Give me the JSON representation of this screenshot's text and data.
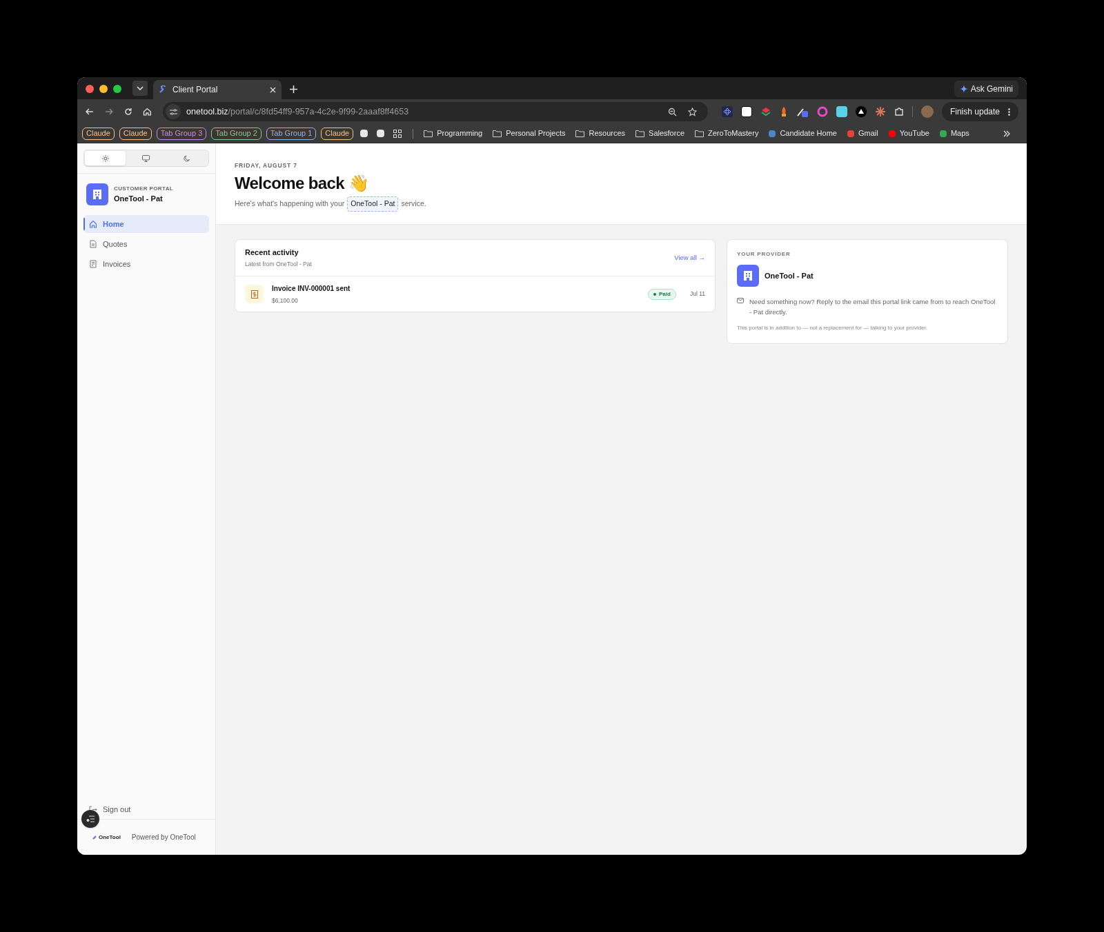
{
  "browser": {
    "tab": {
      "title": "Client Portal"
    },
    "ask_button": "Ask Gemini",
    "url": {
      "host": "onetool.biz",
      "path": "/portal/c/8fd54ff9-957a-4c2e-9f99-2aaaf8ff4653"
    },
    "update_button": "Finish update",
    "bookmarks": [
      {
        "kind": "group",
        "label": "Claude",
        "color": "#f2c48d"
      },
      {
        "kind": "group",
        "label": "Claude",
        "color": "#f2c48d"
      },
      {
        "kind": "group",
        "label": "Tab Group 3",
        "color": "#c58af9"
      },
      {
        "kind": "group",
        "label": "Tab Group 2",
        "color": "#81c995"
      },
      {
        "kind": "group",
        "label": "Tab Group 1",
        "color": "#8ab4f8"
      },
      {
        "kind": "group",
        "label": "Claude",
        "color": "#f2c48d"
      },
      {
        "kind": "page"
      },
      {
        "kind": "page"
      },
      {
        "kind": "apps"
      },
      {
        "kind": "folder",
        "label": "Programming"
      },
      {
        "kind": "folder",
        "label": "Personal Projects"
      },
      {
        "kind": "folder",
        "label": "Resources"
      },
      {
        "kind": "folder",
        "label": "Salesforce"
      },
      {
        "kind": "folder",
        "label": "ZeroToMastery"
      },
      {
        "kind": "site",
        "label": "Candidate Home",
        "color": "#4a86c8"
      },
      {
        "kind": "site",
        "label": "Gmail",
        "color": "#ea4335"
      },
      {
        "kind": "site",
        "label": "YouTube",
        "color": "#ff0000"
      },
      {
        "kind": "site",
        "label": "Maps",
        "color": "#34a853"
      }
    ]
  },
  "theme_toggle": [
    {
      "kind": "light",
      "selected": true
    },
    {
      "kind": "system",
      "selected": false
    },
    {
      "kind": "dark",
      "selected": false
    }
  ],
  "brand": {
    "eyebrow": "CUSTOMER PORTAL",
    "name": "OneTool - Pat"
  },
  "nav": [
    {
      "kind": "home",
      "label": "Home",
      "selected": true
    },
    {
      "kind": "quotes",
      "label": "Quotes",
      "selected": false
    },
    {
      "kind": "invoices",
      "label": "Invoices",
      "selected": false
    }
  ],
  "sign_out": "Sign out",
  "footer": {
    "logo_text": "OneTool",
    "text": "Powered by OneTool"
  },
  "header": {
    "date": "FRIDAY, AUGUST 7",
    "title": "Welcome back 👋",
    "subtitle_before": "Here's what's happening with your",
    "subtitle_chip": "OneTool - Pat",
    "subtitle_after": "service."
  },
  "recent_activity": {
    "title": "Recent activity",
    "subtitle": "Latest from OneTool - Pat",
    "link": "View all →",
    "items": [
      {
        "title": "Invoice INV-000001 sent",
        "amount": "$6,100.00",
        "status": "Paid",
        "date": "Jul 11"
      }
    ]
  },
  "provider": {
    "eyebrow": "YOUR PROVIDER",
    "name": "OneTool - Pat",
    "note": "Need something now? Reply to the email this portal link came from to reach OneTool - Pat directly.",
    "disclaimer": "This portal is in addition to — not a replacement for — talking to your provider."
  }
}
